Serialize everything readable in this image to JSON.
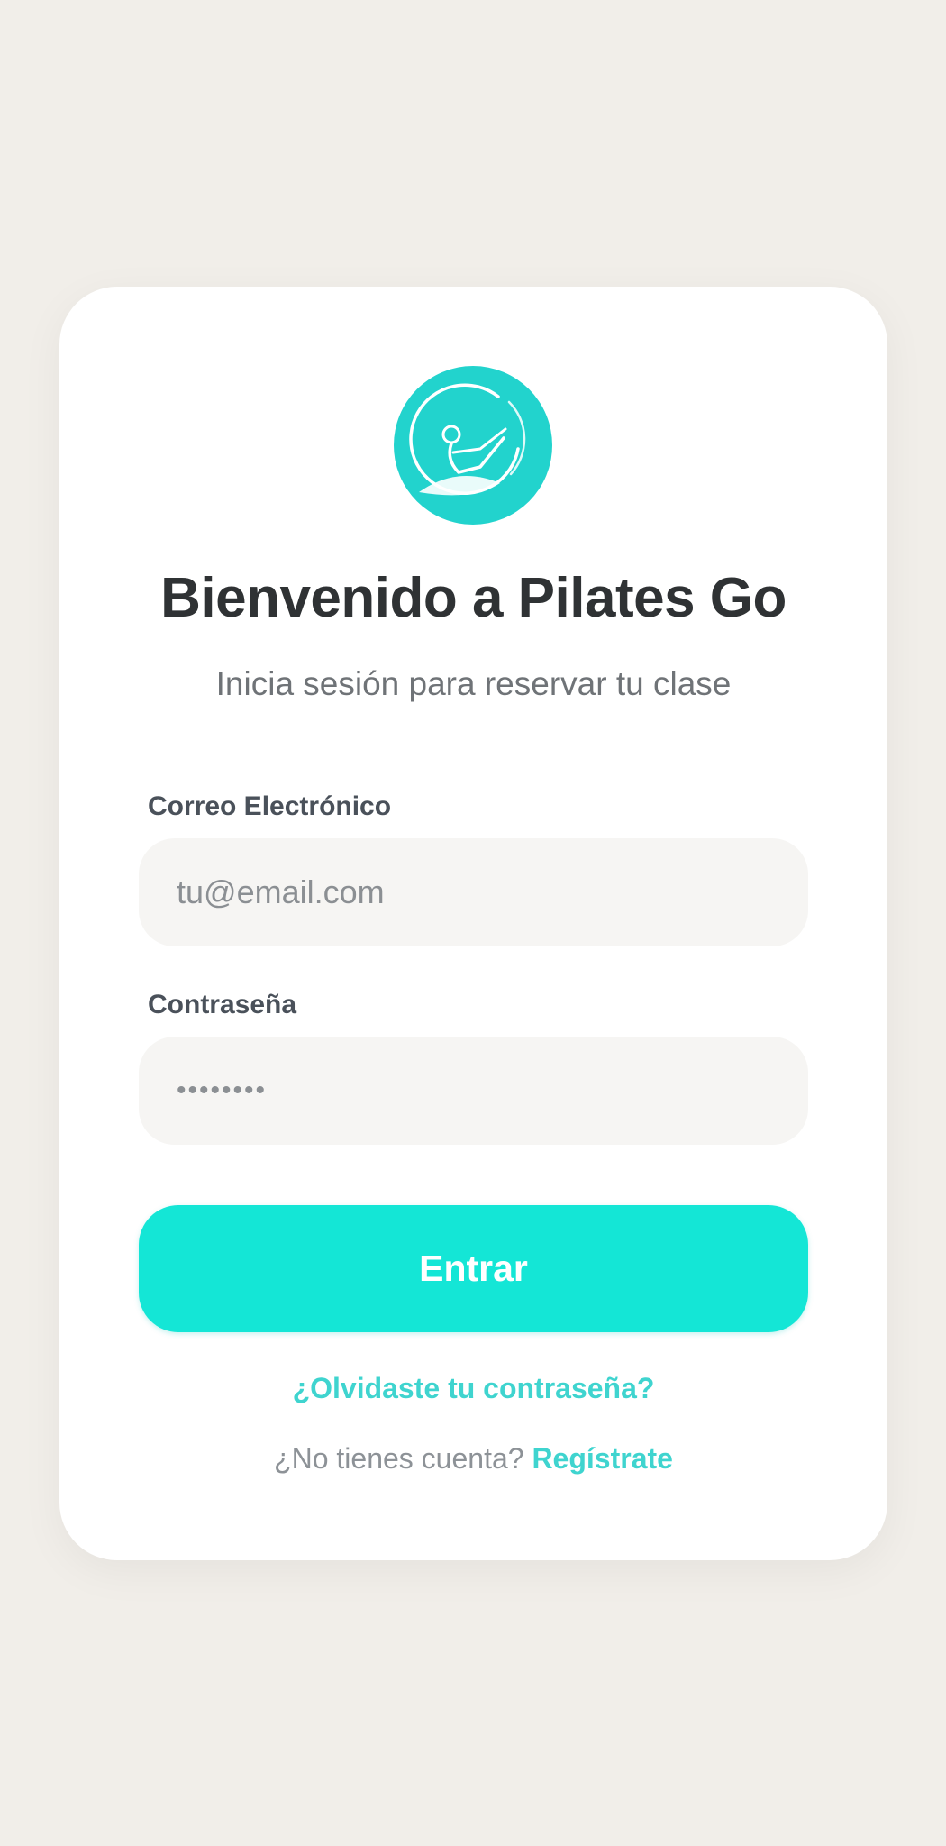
{
  "brand": {
    "accent": "#14e6d6",
    "logo_icon": "pilates-figure-icon"
  },
  "login": {
    "title": "Bienvenido a Pilates Go",
    "subtitle": "Inicia sesión para reservar tu clase",
    "email": {
      "label": "Correo Electrónico",
      "placeholder": "tu@email.com",
      "value": ""
    },
    "password": {
      "label": "Contraseña",
      "value": "••••••••"
    },
    "submit_label": "Entrar",
    "forgot_label": "¿Olvidaste tu contraseña?",
    "signup_prompt": "¿No tienes cuenta?",
    "signup_link": "Regístrate"
  }
}
